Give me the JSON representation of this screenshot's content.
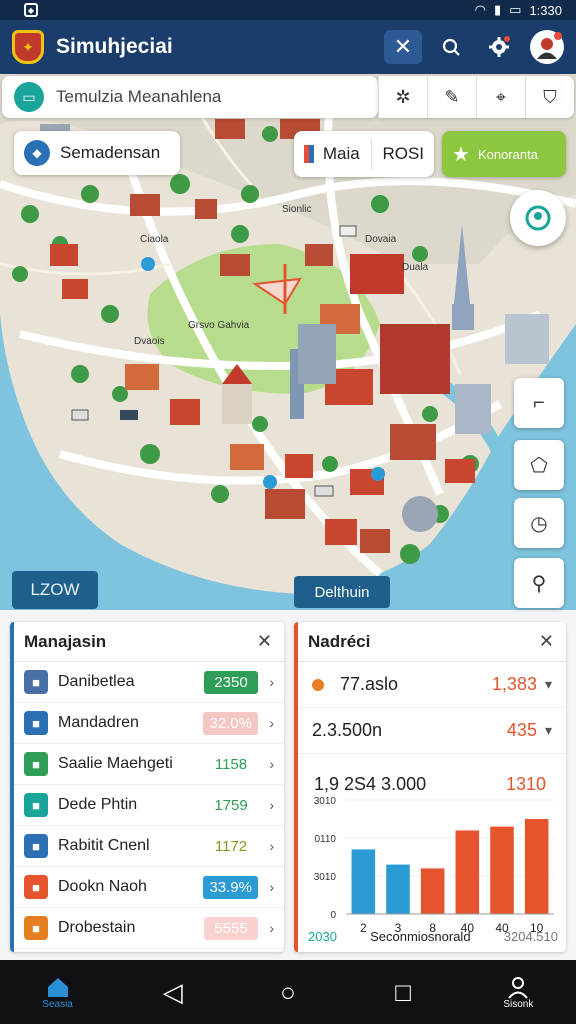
{
  "status": {
    "time": "1:330"
  },
  "app": {
    "title": "Simuhjeciai"
  },
  "search": {
    "text": "Temulzia Meanahlena"
  },
  "chips": {
    "location": "Semadensan",
    "pair_left": "Maia",
    "pair_right": "ROSI",
    "favorite": "Konoranta"
  },
  "map": {
    "zoom_label": "LZOW",
    "caption": "Delthuin",
    "labels": [
      {
        "text": "Ciaola"
      },
      {
        "text": "Grsvo Gahvia"
      },
      {
        "text": "Dovaia"
      },
      {
        "text": "Duala"
      },
      {
        "text": "Dvaois"
      },
      {
        "text": "Sionlic"
      }
    ]
  },
  "left_panel": {
    "title": "Manajasin",
    "rows": [
      {
        "label": "Danibetlea",
        "value": "2350",
        "icon": "mask-icon",
        "icon_color": "#4a6fa5",
        "value_bg": "#2e9e57",
        "value_color": "#ffffff"
      },
      {
        "label": "Mandadren",
        "value": "32.0%",
        "icon": "clipboard-icon",
        "icon_color": "#2b6fb5",
        "value_bg": "#f4c7c3",
        "value_color": "#ffffff"
      },
      {
        "label": "Saalie Maehgeti",
        "value": "1158",
        "icon": "leaf-icon",
        "icon_color": "#2e9e57",
        "value_bg": "transparent",
        "value_color": "#2e9e57"
      },
      {
        "label": "Dede Phtin",
        "value": "1759",
        "icon": "pencil-icon",
        "icon_color": "#1aa59b",
        "value_bg": "transparent",
        "value_color": "#2e9e57"
      },
      {
        "label": "Rabitit Cnenl",
        "value": "1172",
        "icon": "document-icon",
        "icon_color": "#2b6fb5",
        "value_bg": "transparent",
        "value_color": "#7a9c1f"
      },
      {
        "label": "Dookn Naoh",
        "value": "33.9%",
        "icon": "chart-icon",
        "icon_color": "#e4552e",
        "value_bg": "#2b9bd6",
        "value_color": "#ffffff"
      },
      {
        "label": "Drobestain",
        "value": "5555",
        "icon": "coin-icon",
        "icon_color": "#e67e22",
        "value_bg": "#f9d2d0",
        "value_color": "#ffffff"
      }
    ]
  },
  "right_panel": {
    "title": "Nadréci",
    "stats": [
      {
        "label": "77.aslo",
        "value": "1,383"
      },
      {
        "label": "2.3.500n",
        "value": "435"
      }
    ]
  },
  "chart_data": {
    "type": "bar",
    "title": "1,9 2S4 3.000",
    "max_label": "1310",
    "categories": [
      "2",
      "3",
      "8",
      "40",
      "40",
      "10"
    ],
    "values": [
      17,
      13,
      12,
      22,
      23,
      25
    ],
    "ylim": [
      0,
      30
    ],
    "yticks": [
      "0",
      "3010",
      "0110",
      "3010"
    ],
    "colors": [
      "#2b9bd6",
      "#2b9bd6",
      "#e4552e",
      "#e4552e",
      "#e4552e",
      "#e4552e"
    ],
    "footer_left": "2030",
    "footer_mid": "Seconmiosnorald",
    "footer_right": "3204.510"
  },
  "nav": {
    "home_label": "Seasia",
    "right_label": "Sisonk"
  }
}
